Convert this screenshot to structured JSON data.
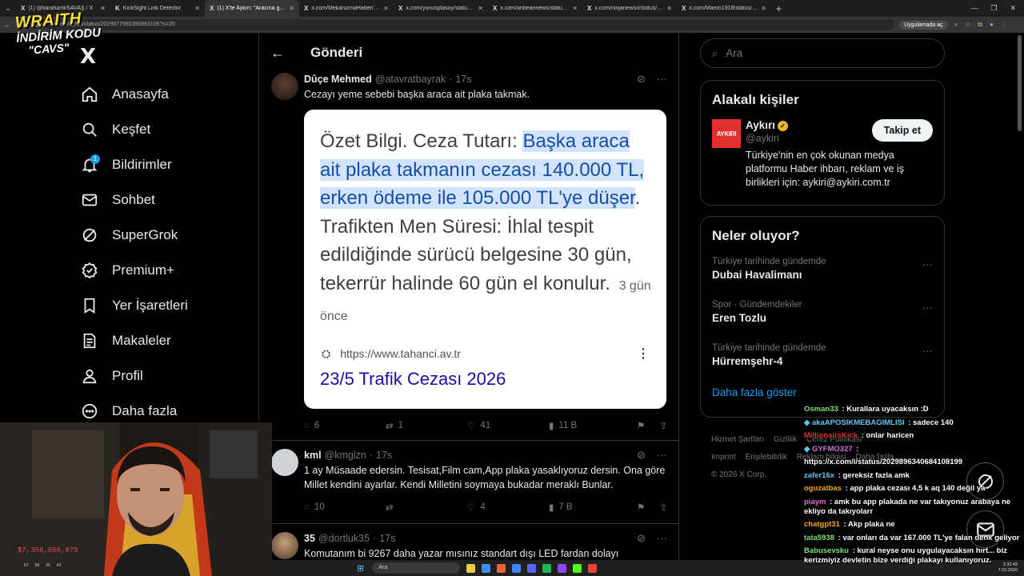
{
  "browser": {
    "tabs": [
      {
        "icon": "X",
        "label": "(1) @karahanli/SAVAŞ / X"
      },
      {
        "icon": "K",
        "label": "KickSight Link Detector"
      },
      {
        "icon": "X",
        "label": "(1) X'te Aykırı: \"Aracına gelen ce",
        "active": true
      },
      {
        "icon": "X",
        "label": "x.com/MekanizmaHaber/status/20"
      },
      {
        "icon": "X",
        "label": "x.com/yunusplasoy/status/203"
      },
      {
        "icon": "X",
        "label": "x.com/anbeannews/status/202"
      },
      {
        "icon": "X",
        "label": "x.com/ninjanewsx/status/20299"
      },
      {
        "icon": "X",
        "label": "x.com/Maron1918/status/2030"
      }
    ],
    "url": "x.com/aykiri/status/2029977560356983106?s=20",
    "app_button": "Uygulamada aç"
  },
  "overlay": {
    "brand": "WRAITH",
    "promo": "İNDİRİM KODU",
    "code": "\"CAVS\"",
    "balance": "$7,356,056,979",
    "stats": [
      "07",
      "88",
      "32",
      "43"
    ]
  },
  "nav": {
    "logo": "X",
    "items": [
      {
        "label": "Anasayfa",
        "icon": "home-icon"
      },
      {
        "label": "Keşfet",
        "icon": "search-icon"
      },
      {
        "label": "Bildirimler",
        "icon": "bell-icon",
        "badge": "1"
      },
      {
        "label": "Sohbet",
        "icon": "mail-icon"
      },
      {
        "label": "SuperGrok",
        "icon": "grok-icon"
      },
      {
        "label": "Premium+",
        "icon": "verified-icon"
      },
      {
        "label": "Yer İşaretleri",
        "icon": "bookmark-icon"
      },
      {
        "label": "Makaleler",
        "icon": "article-icon"
      },
      {
        "label": "Profil",
        "icon": "profile-icon"
      },
      {
        "label": "Daha fazla",
        "icon": "more-icon"
      }
    ]
  },
  "main": {
    "title": "Gönderi",
    "tweet1": {
      "name": "Dûçe Mehmed",
      "handle": "@atavratbayrak",
      "time": "17s",
      "text": "Cezayı yeme sebebi başka araca ait plaka takmak.",
      "card": {
        "prefix": "Özet Bilgi. Ceza Tutarı: ",
        "highlight": "Başka araca ait plaka takmanın cezası 140.000 TL, erken ödeme ile 105.000 TL'ye düşer",
        "rest": ". Trafikten Men Süresi: İhlal tespit edildiğinde sürücü belgesine 30 gün, tekerrür halinde 60 gün el konulur.",
        "ago": "3 gün önce",
        "url": "https://www.tahanci.av.tr",
        "link": "23/5 Trafik Cezası 2026"
      },
      "replies": "6",
      "reposts": "1",
      "likes": "41",
      "views": "11 B"
    },
    "tweet2": {
      "name": "kml",
      "handle": "@kmglzn",
      "time": "17s",
      "text": "1 ay Müsaade edersin. Tesisat,Film cam,App plaka yasaklıyoruz dersin. Ona göre Millet kendini ayarlar. Kendi Milletini soymaya bukadar meraklı Bunlar.",
      "replies": "10",
      "reposts": "",
      "likes": "4",
      "views": "7 B"
    },
    "tweet3": {
      "name": "35",
      "handle": "@dortluk35",
      "time": "17s",
      "text": "Komutanım bi 9267 daha yazar mısınız standart dışı LED fardan dolayı"
    }
  },
  "right": {
    "search_placeholder": "Ara",
    "related": {
      "title": "Alakalı kişiler",
      "name": "Aykırı",
      "handle": "@aykiri",
      "avatar_text": "AYKIRI",
      "bio": "Türkiye'nin en çok okunan medya platformu Haber ihbarı, reklam ve iş birlikleri için: aykiri@aykiri.com.tr",
      "follow": "Takip et"
    },
    "trends": {
      "title": "Neler oluyor?",
      "items": [
        {
          "category": "Türkiye tarihinde gündemde",
          "name": "Dubai Havalimanı"
        },
        {
          "category": "Spor · Gündemdekiler",
          "name": "Eren Tozlu"
        },
        {
          "category": "Türkiye tarihinde gündemde",
          "name": "Hürremşehr-4"
        }
      ],
      "more": "Daha fazla göster"
    },
    "footer": {
      "terms": "Hizmet Şartları",
      "privacy": "Gizlilik",
      "cookie": "Çerez Politikası",
      "imprint": "Imprint",
      "access": "Erişilebilirlik",
      "ads": "Reklam bilgisi",
      "more": "Daha fazla ...",
      "copyright": "© 2026 X Corp."
    }
  },
  "chat": [
    {
      "user": "Osman33",
      "color": "#7be07b",
      "msg": "Kurallara uyacaksın :D"
    },
    {
      "user": "akaAPOSIKMEBAGIMLISI",
      "color": "#5bc8f5",
      "msg": "sadece 140"
    },
    {
      "user": "MillionairsKick",
      "color": "#e03030",
      "msg": "onlar haricen"
    },
    {
      "user": "GYFMO327",
      "color": "#d16fd8",
      "msg": ""
    },
    {
      "user": "",
      "color": "#ffffff",
      "msg": "https://x.com/i/status/2029896340684108199"
    },
    {
      "user": "zafer16x",
      "color": "#5bc8f5",
      "msg": "gereksiz fazla amk"
    },
    {
      "user": "oguzatbas",
      "color": "#f5a623",
      "msg": "app plaka cezası 4,5 k aq 140 değil ya"
    },
    {
      "user": "piaym",
      "color": "#e86bd0",
      "msg": "amk bu app plakada ne var takıyonuz arabaya ne ekliyo da takıyolarr"
    },
    {
      "user": "chatgpt31",
      "color": "#f5a623",
      "msg": "Akp plaka ne"
    },
    {
      "user": "tata5938",
      "color": "#7be07b",
      "msg": "var onları da var 167.000 TL'ye falan denk geliyor"
    },
    {
      "user": "Babusevsku",
      "color": "#7be07b",
      "msg": "kural neyse onu uygulayacaksın hırt... biz kerizmiyiz devletin bize verdiği plakayı kullanıyoruz."
    }
  ],
  "taskbar": {
    "search": "Ara",
    "time": "3:32:43",
    "date": "7.03.2026"
  }
}
